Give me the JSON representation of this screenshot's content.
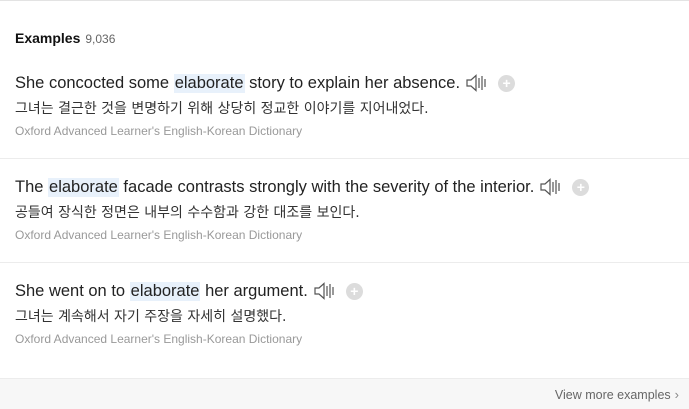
{
  "section": {
    "title": "Examples",
    "count": "9,036"
  },
  "examples": [
    {
      "before": "She concocted some ",
      "keyword": "elaborate",
      "after": " story to explain her absence.",
      "korean": "그녀는 결근한 것을 변명하기 위해 상당히 정교한 이야기를 지어내었다.",
      "source": "Oxford Advanced Learner's English-Korean Dictionary",
      "speaker_icon": "speaker-icon",
      "add_icon": "plus-icon"
    },
    {
      "before": "The ",
      "keyword": "elaborate",
      "after": " facade contrasts strongly with the severity of the interior.",
      "korean": "공들여 장식한 정면은 내부의 수수함과 강한 대조를 보인다.",
      "source": "Oxford Advanced Learner's English-Korean Dictionary",
      "speaker_icon": "speaker-icon",
      "add_icon": "plus-icon"
    },
    {
      "before": "She went on to ",
      "keyword": "elaborate",
      "after": " her argument.",
      "korean": "그녀는 계속해서 자기 주장을 자세히 설명했다.",
      "source": "Oxford Advanced Learner's English-Korean Dictionary",
      "speaker_icon": "speaker-icon",
      "add_icon": "plus-icon"
    }
  ],
  "footer": {
    "view_more": "View more examples",
    "chevron": "›"
  },
  "colors": {
    "highlight": "#e8f1fb",
    "source_text": "#999999",
    "add_button": "#dcdcdc"
  }
}
